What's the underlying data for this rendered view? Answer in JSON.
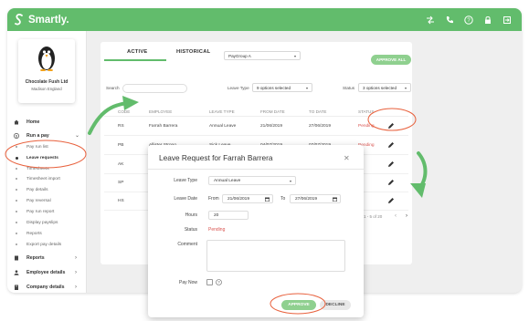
{
  "brand": {
    "name": "Smartly."
  },
  "colors": {
    "accent": "#62bc6c",
    "approve": "#8fd08f",
    "pending": "#d9534f",
    "annotation": "#e8603c"
  },
  "header_icons": [
    "shuffle-icon",
    "phone-icon",
    "help-icon",
    "lock-icon",
    "logout-icon"
  ],
  "company": {
    "name": "Chocolate Fush Ltd",
    "location": "Madison England"
  },
  "sidebar": {
    "items": [
      {
        "label": "Home",
        "icon": "home-icon"
      },
      {
        "label": "Run a pay",
        "icon": "dollar-icon"
      }
    ],
    "subitems": [
      "Pay run list",
      "Leave requests",
      "Timesheets",
      "Timesheet import",
      "Pay details",
      "Pay reversal",
      "Pay run report",
      "Display payslips",
      "Reports",
      "Export pay details"
    ],
    "bottom_items": [
      {
        "label": "Reports",
        "icon": "report-icon"
      },
      {
        "label": "Employee details",
        "icon": "person-icon"
      },
      {
        "label": "Company details",
        "icon": "building-icon"
      }
    ]
  },
  "main": {
    "tabs": [
      "ACTIVE",
      "HISTORICAL"
    ],
    "paygroup": "PayGroup A",
    "approve_all": "APPROVE ALL",
    "search_label": "Search",
    "leave_type_label": "Leave Type",
    "leave_type_value": "9 options selected",
    "status_label": "Status",
    "status_value": "3 options selected",
    "columns": [
      "CODE",
      "EMPLOYEE",
      "LEAVE TYPE",
      "FROM DATE",
      "TO DATE",
      "STATUS"
    ],
    "rows": [
      {
        "code": "RS",
        "employee": "Farrah Barrera",
        "leave_type": "Annual Leave",
        "from": "21/06/2019",
        "to": "27/06/2019",
        "status": "Pending"
      },
      {
        "code": "PB",
        "employee": "Allister Strong",
        "leave_type": "Sick Leave",
        "from": "04/07/2019",
        "to": "07/07/2019",
        "status": "Pending"
      },
      {
        "code": "AK",
        "employee": "Ma",
        "leave_type": "",
        "from": "",
        "to": "",
        "status": ""
      },
      {
        "code": "SP",
        "employee": "Be",
        "leave_type": "",
        "from": "",
        "to": "",
        "status": ""
      },
      {
        "code": "HS",
        "employee": "Ne",
        "leave_type": "",
        "from": "",
        "to": "",
        "status": ""
      }
    ],
    "pagination": "1 - 5 of 20"
  },
  "modal": {
    "title": "Leave Request for Farrah Barrera",
    "leave_type_label": "Leave Type",
    "leave_type_value": "Annual Leave",
    "leave_date_label": "Leave Date",
    "from_label": "From",
    "from_value": "21/06/2019",
    "to_label": "To",
    "to_value": "27/06/2019",
    "hours_label": "Hours",
    "hours_value": "20",
    "status_label": "Status",
    "status_value": "Pending",
    "comment_label": "Comment",
    "pay_now_label": "Pay Now",
    "approve": "APPROVE",
    "decline": "DECLINE"
  }
}
